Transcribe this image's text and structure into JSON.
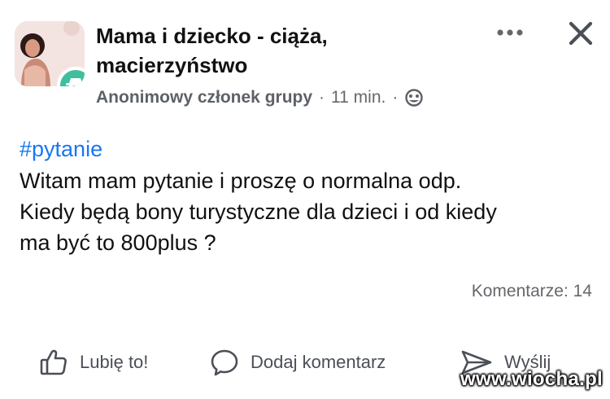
{
  "group": {
    "title": "Mama i dziecko - ciąża, macierzyństwo"
  },
  "meta": {
    "author": "Anonimowy członek grupy",
    "separator": "·",
    "time": "11 min.",
    "separator2": "·"
  },
  "post": {
    "hashtag": "#pytanie",
    "lines": [
      "Witam mam pytanie i proszę o normalna odp.",
      "Kiedy będą bony turystyczne dla dzieci i od kiedy",
      "ma być to 800plus ?"
    ]
  },
  "stats": {
    "comments": "Komentarze: 14"
  },
  "actions": {
    "like": "Lubię to!",
    "comment": "Dodaj komentarz",
    "send": "Wyślij"
  },
  "watermark": "www.wiocha.pl",
  "colors": {
    "link": "#1877f2",
    "anonymous_badge": "#3fbf9c",
    "secondary_text": "#65676b"
  }
}
